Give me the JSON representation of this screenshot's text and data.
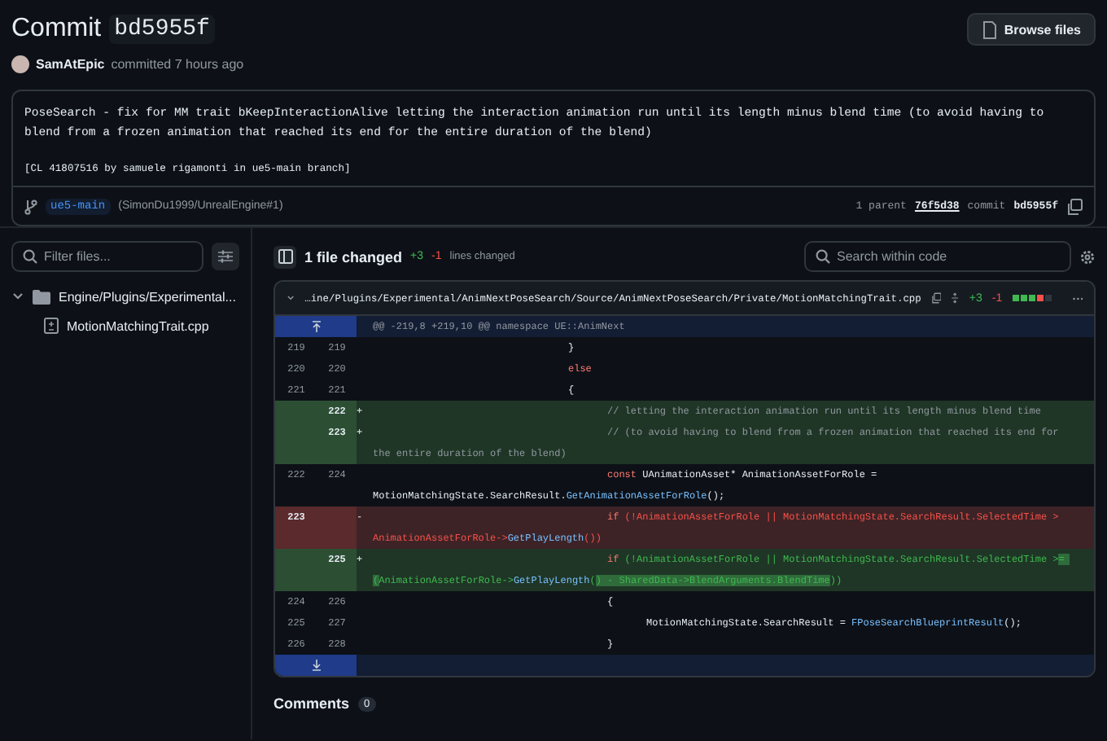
{
  "header": {
    "title": "Commit",
    "sha": "bd5955f",
    "browse_button": "Browse files"
  },
  "author": {
    "name": "SamAtEpic",
    "action": "committed 7 hours ago"
  },
  "message": {
    "summary": "PoseSearch - fix for MM trait bKeepInteractionAlive letting the interaction animation run until its length minus blend time (to avoid having to blend from a frozen animation that reached its end for the entire duration of the blend)",
    "trailer": "[CL 41807516 by samuele rigamonti in ue5-main branch]"
  },
  "commit_footer": {
    "branch": "ue5-main",
    "pull_ref": "(SimonDu1999/UnrealEngine#1)",
    "parent_count": "1 parent",
    "parent_sha": "76f5d38",
    "commit_label": "commit",
    "commit_sha": "bd5955f"
  },
  "sidebar": {
    "filter": {
      "placeholder": "Filter files..."
    },
    "tree": [
      {
        "label": "Engine/Plugins/Experimental...",
        "kind": "folder",
        "expanded": true,
        "children": [
          {
            "label": "MotionMatchingTrait.cpp",
            "kind": "file"
          }
        ]
      }
    ]
  },
  "diff_toolbar": {
    "files_changed": "1 file changed",
    "additions": "+3",
    "deletions": "-1",
    "lines_label": "lines changed",
    "search": {
      "placeholder": "Search within code"
    }
  },
  "file": {
    "expanded": true,
    "path": "…ine/Plugins/Experimental/AnimNextPoseSearch/Source/AnimNextPoseSearch/Private/MotionMatchingTrait.cpp",
    "additions": "+3",
    "deletions": "-1",
    "diffstat": [
      {
        "kind": "add"
      },
      {
        "kind": "add"
      },
      {
        "kind": "add"
      },
      {
        "kind": "del"
      },
      {
        "kind": "neutral"
      }
    ],
    "lines": [
      {
        "kind": "hunk",
        "text": "@@ -219,8 +219,10 @@ namespace UE::AnimNext"
      },
      {
        "kind": "context",
        "old": "219",
        "new": "219",
        "code": [
          {
            "text": "\t\t\t\t\t}",
            "kind": "plain"
          }
        ]
      },
      {
        "kind": "context",
        "old": "220",
        "new": "220",
        "code": [
          {
            "text": "\t\t\t\t\telse",
            "kind": "keyword"
          }
        ]
      },
      {
        "kind": "context",
        "old": "221",
        "new": "221",
        "code": [
          {
            "text": "\t\t\t\t\t{",
            "kind": "plain"
          }
        ]
      },
      {
        "kind": "add",
        "new": "222",
        "sign": "+",
        "code": [
          {
            "text": "\t\t\t\t\t\t// letting the interaction animation run until its length minus blend time",
            "kind": "comment"
          }
        ]
      },
      {
        "kind": "add",
        "new": "223",
        "sign": "+",
        "code": [
          {
            "text": "\t\t\t\t\t\t// (to avoid having to blend from a frozen animation that reached its end for the entire duration of the blend)",
            "kind": "comment"
          }
        ]
      },
      {
        "kind": "context",
        "old": "222",
        "new": "224",
        "code": [
          {
            "text": "\t\t\t\t\t\tconst",
            "kind": "keyword"
          },
          {
            "text": " UAnimationAsset* AnimationAssetForRole = MotionMatchingState.SearchResult.",
            "kind": "plain"
          },
          {
            "text": "GetAnimationAssetForRole",
            "kind": "func"
          },
          {
            "text": "();",
            "kind": "plain"
          }
        ]
      },
      {
        "kind": "del",
        "old": "223",
        "sign": "-",
        "code": [
          {
            "text": "\t\t\t\t\t\tif",
            "kind": "keyword"
          },
          {
            "text": " (!AnimationAssetForRole || MotionMatchingState.SearchResult.SelectedTime > AnimationAssetForRole->",
            "kind": "plain"
          },
          {
            "text": "GetPlayLength",
            "kind": "func"
          },
          {
            "text": "())",
            "kind": "plain"
          }
        ]
      },
      {
        "kind": "add",
        "new": "225",
        "sign": "+",
        "code": [
          {
            "text": "\t\t\t\t\t\tif",
            "kind": "keyword"
          },
          {
            "text": " (!AnimationAssetForRole || MotionMatchingState.SearchResult.SelectedTime >",
            "kind": "plain"
          },
          {
            "text": "= (",
            "kind": "changed"
          },
          {
            "text": "AnimationAssetForRole->",
            "kind": "plain"
          },
          {
            "text": "GetPlayLength",
            "kind": "func"
          },
          {
            "text": "(",
            "kind": "plain"
          },
          {
            "text": ") - SharedData->BlendArguments.BlendTime",
            "kind": "changed"
          },
          {
            "text": "))",
            "kind": "plain"
          }
        ]
      },
      {
        "kind": "context",
        "old": "224",
        "new": "226",
        "code": [
          {
            "text": "\t\t\t\t\t\t{",
            "kind": "plain"
          }
        ]
      },
      {
        "kind": "context",
        "old": "225",
        "new": "227",
        "code": [
          {
            "text": "\t\t\t\t\t\t\tMotionMatchingState.SearchResult = ",
            "kind": "plain"
          },
          {
            "text": "FPoseSearchBlueprintResult",
            "kind": "func"
          },
          {
            "text": "();",
            "kind": "plain"
          }
        ]
      },
      {
        "kind": "context",
        "old": "226",
        "new": "228",
        "code": [
          {
            "text": "\t\t\t\t\t\t}",
            "kind": "plain"
          }
        ]
      },
      {
        "kind": "expand"
      }
    ]
  },
  "comments": {
    "title": "Comments",
    "count": "0"
  }
}
